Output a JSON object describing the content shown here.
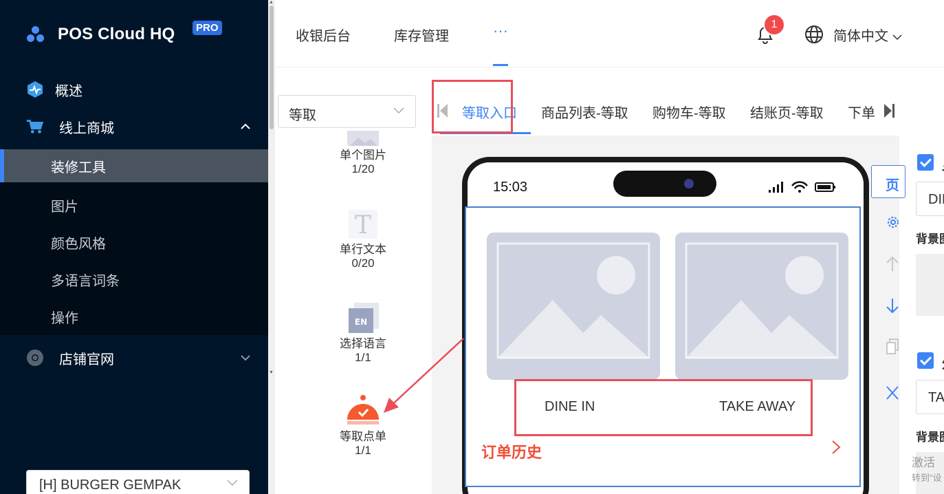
{
  "sidebar": {
    "brand": "POS Cloud HQ",
    "brand_badge": "PRO",
    "menu": [
      {
        "label": "概述",
        "icon": "dashboard-icon"
      },
      {
        "label": "线上商城",
        "icon": "cart-icon",
        "expanded": true
      },
      {
        "label": "店铺官网",
        "icon": "chrome-icon",
        "expanded": false
      }
    ],
    "submenu": [
      {
        "label": "装修工具",
        "active": true
      },
      {
        "label": "图片"
      },
      {
        "label": "颜色风格"
      },
      {
        "label": "多语言词条"
      },
      {
        "label": "操作"
      }
    ],
    "store_select": "[H] BURGER GEMPAK"
  },
  "header": {
    "tabs": [
      "收银后台",
      "库存管理",
      "···"
    ],
    "notification_count": "1",
    "language": "简体中文"
  },
  "components": {
    "type_select": "等取",
    "items": [
      {
        "label": "单个图片",
        "count": "1/20",
        "icon": "image-icon"
      },
      {
        "label": "单行文本",
        "count": "0/20",
        "icon": "text-icon"
      },
      {
        "label": "选择语言",
        "count": "1/1",
        "icon": "language-icon",
        "icon_text": "EN"
      },
      {
        "label": "等取点单",
        "count": "1/1",
        "icon": "cloche-icon"
      }
    ]
  },
  "page_tabs": [
    "等取入口",
    "商品列表-等取",
    "购物车-等取",
    "结账页-等取",
    "下单"
  ],
  "phone": {
    "time": "15:03",
    "buttons": [
      "DINE IN",
      "TAKE AWAY"
    ],
    "history_label": "订单历史"
  },
  "tools": {
    "page_button": "页"
  },
  "props": {
    "checkbox1_label": "显",
    "input1_value": "DINE IN",
    "bg_label1": "背景图",
    "checkbox2_label": "外",
    "input2_value": "TAKE AWAY",
    "bg_label2": "背景图"
  },
  "watermark": {
    "line1": "激活",
    "line2": "转到\"设"
  },
  "colors": {
    "sidebar_bg": "#001529",
    "accent": "#3d84f7",
    "annotation": "#e84f5b",
    "history": "#f04e37"
  }
}
